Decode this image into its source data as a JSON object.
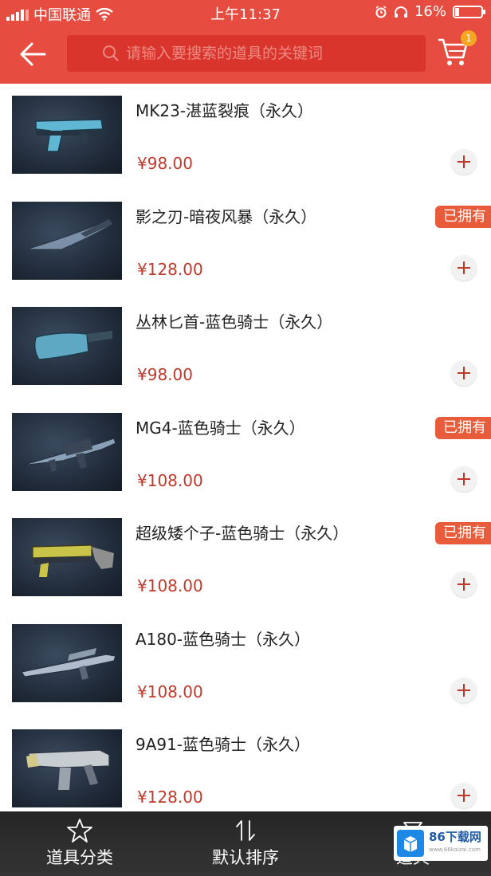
{
  "status_bar": {
    "carrier": "中国联通",
    "time": "上午11:37",
    "battery": "16%"
  },
  "header": {
    "search_placeholder": "请输入要搜索的道具的关键词",
    "cart_badge": "1"
  },
  "items": [
    {
      "name": "MK23-湛蓝裂痕（永久）",
      "price": "¥98.00",
      "owned": ""
    },
    {
      "name": "影之刃-暗夜风暴（永久）",
      "price": "¥128.00",
      "owned": "已拥有"
    },
    {
      "name": "丛林匕首-蓝色骑士（永久）",
      "price": "¥98.00",
      "owned": ""
    },
    {
      "name": "MG4-蓝色骑士（永久）",
      "price": "¥108.00",
      "owned": "已拥有"
    },
    {
      "name": "超级矮个子-蓝色骑士（永久）",
      "price": "¥108.00",
      "owned": "已拥有"
    },
    {
      "name": "A180-蓝色骑士（永久）",
      "price": "¥108.00",
      "owned": ""
    },
    {
      "name": "9A91-蓝色骑士（永久）",
      "price": "¥128.00",
      "owned": ""
    }
  ],
  "bottom_bar": {
    "tab_category": "道具分类",
    "tab_sort": "默认排序",
    "tab_third": "道具"
  },
  "watermark": {
    "text": "86下载网",
    "sub": "www.86kaizai.com"
  },
  "colors": {
    "brand_red": "#e74c40",
    "price_red": "#c0392b",
    "owned_badge": "#e85c3c"
  }
}
